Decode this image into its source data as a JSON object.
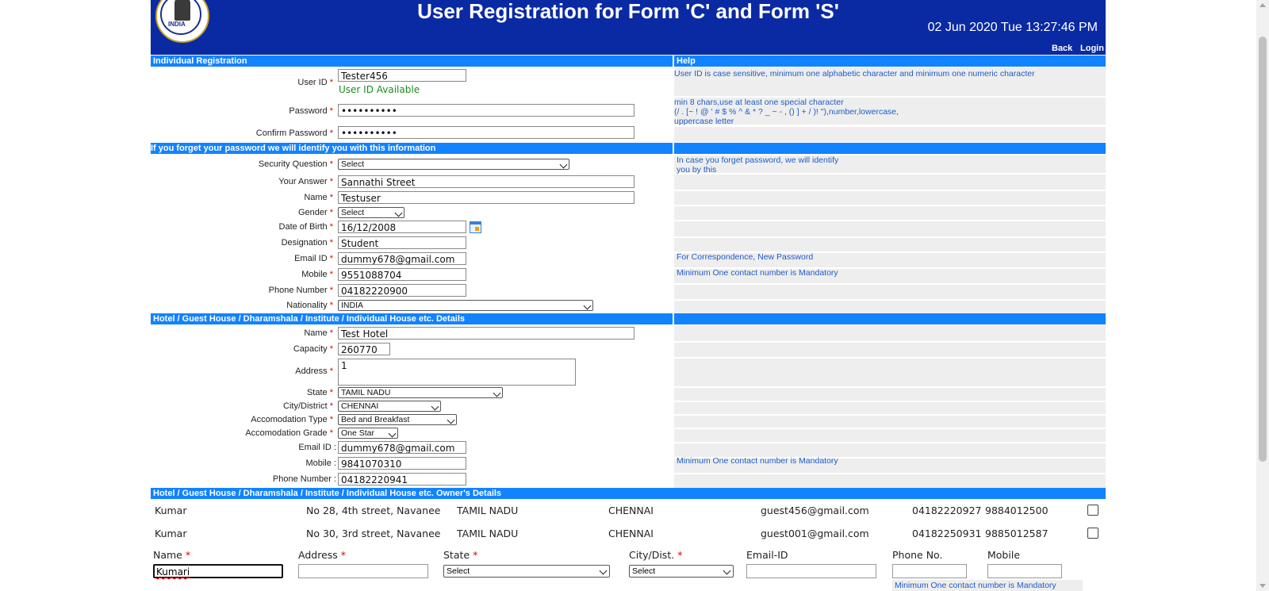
{
  "header": {
    "title": "User Registration for Form 'C' and Form 'S'",
    "datetime": "02 Jun 2020 Tue 13:27:46 PM",
    "logo_text": "INDIA"
  },
  "nav": {
    "back": "Back",
    "login": "Login"
  },
  "sections": {
    "individual": "Individual Registration",
    "help": "Help",
    "security": "If you forget your password we will identify you with this information",
    "hotel": "Hotel / Guest House / Dharamshala / Institute / Individual House etc. Details",
    "owner": "Hotel / Guest House / Dharamshala / Institute / Individual House etc.  Owner's Details"
  },
  "help": {
    "userid": "User ID is case sensitive, minimum one alphabetic character and minimum one numeric character",
    "password_line1": "min 8 chars,use at least one special character",
    "password_line2": "(/ . [~ ! @ ' # $ % ^ & * ? _ ~ - , () ] + / )! \"),number,lowercase,",
    "password_line3": "uppercase letter",
    "security_line1": "In case you forget password, we will identify",
    "security_line2": "you by this",
    "email": "For Correspondence, New Password",
    "contact": "Minimum One contact number is Mandatory",
    "hotel_contact": "Minimum One contact number is Mandatory"
  },
  "individual": {
    "userid": {
      "label": "User ID",
      "value": "Tester456",
      "status": "User ID Available"
    },
    "password": {
      "label": "Password",
      "value": "••••••••••"
    },
    "confirm_password": {
      "label": "Confirm Password",
      "value": "••••••••••"
    },
    "security_question": {
      "label": "Security Question",
      "value": "Select"
    },
    "answer": {
      "label": "Your Answer",
      "value": "Sannathi Street"
    },
    "name": {
      "label": "Name",
      "value": "Testuser"
    },
    "gender": {
      "label": "Gender",
      "value": "Select"
    },
    "dob": {
      "label": "Date of Birth",
      "value": "16/12/2008"
    },
    "designation": {
      "label": "Designation",
      "value": "Student"
    },
    "email": {
      "label": "Email ID",
      "value": "dummy678@gmail.com"
    },
    "mobile": {
      "label": "Mobile",
      "value": "9551088704"
    },
    "phone": {
      "label": "Phone Number",
      "value": "04182220900"
    },
    "nationality": {
      "label": "Nationality",
      "value": "INDIA"
    }
  },
  "hotel": {
    "name": {
      "label": "Name",
      "value": "Test Hotel"
    },
    "capacity": {
      "label": "Capacity",
      "value": "260770"
    },
    "address": {
      "label": "Address",
      "value": "1"
    },
    "state": {
      "label": "State",
      "value": "TAMIL NADU"
    },
    "city": {
      "label": "City/District",
      "value": "CHENNAI"
    },
    "acc_type": {
      "label": "Accomodation Type",
      "value": "Bed and Breakfast"
    },
    "acc_grade": {
      "label": "Accomodation Grade",
      "value": "One Star"
    },
    "email": {
      "label": "Email ID :",
      "value": "dummy678@gmail.com"
    },
    "mobile": {
      "label": "Mobile :",
      "value": "9841070310"
    },
    "phone": {
      "label": "Phone Number :",
      "value": "04182220941"
    }
  },
  "owners": [
    {
      "name": "Kumar",
      "address": "No 28, 4th street, Navanee",
      "state": "TAMIL NADU",
      "city": "CHENNAI",
      "email": "guest456@gmail.com",
      "phone": "04182220927",
      "mobile": "9884012500"
    },
    {
      "name": "Kumar",
      "address": "No 30, 3rd street, Navanee",
      "state": "TAMIL NADU",
      "city": "CHENNAI",
      "email": "guest001@gmail.com",
      "phone": "04182250931",
      "mobile": "9885012587"
    }
  ],
  "owner_form": {
    "name_label": "Name",
    "name_value": "Kumari",
    "address_label": "Address",
    "state_label": "State",
    "state_value": "Select",
    "city_label": "City/Dist.",
    "city_value": "Select",
    "email_label": "Email-ID",
    "phone_label": "Phone No.",
    "mobile_label": "Mobile",
    "contact_note": "Minimum One contact number is Mandatory"
  },
  "colors": {
    "header": "#0a2aa3",
    "bar": "#1283ff",
    "help_text": "#1e5bc6",
    "required": "#e00000",
    "available": "#1e8a1e"
  }
}
